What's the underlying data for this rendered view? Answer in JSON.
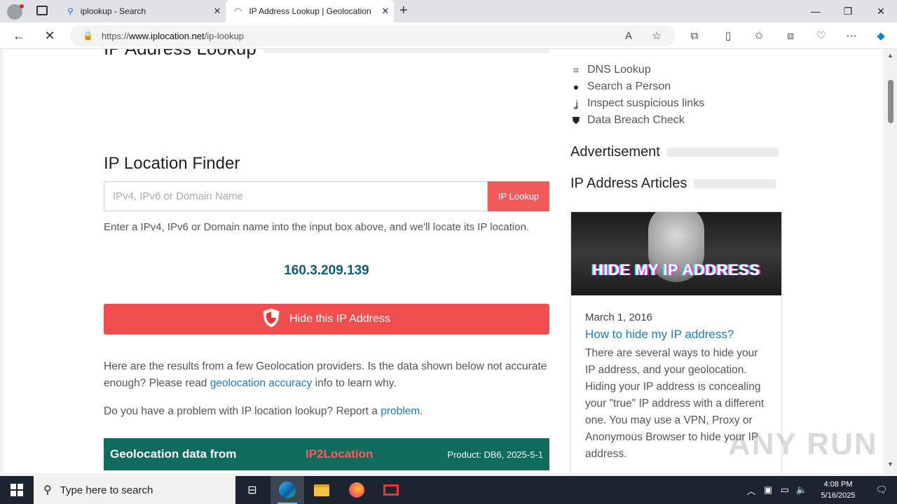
{
  "browser": {
    "tabs": [
      {
        "label": "iplookup - Search"
      },
      {
        "label": "IP Address Lookup | Geolocation"
      }
    ],
    "url_prefix": "https://",
    "url_domain": "www.iplocation.net",
    "url_path": "/ip-lookup"
  },
  "main": {
    "heading_cut": "IP Address Lookup",
    "finder_title": "IP Location Finder",
    "input_placeholder": "IPv4, IPv6 or Domain Name",
    "lookup_button": "IP Lookup",
    "hint": "Enter a IPv4, IPv6 or Domain name into the input box above, and we'll locate its IP location.",
    "current_ip": "160.3.209.139",
    "hide_button": "Hide this IP Address",
    "para1_a": "Here are the results from a few Geolocation providers. Is the data shown below not accurate enough? Please read ",
    "para1_link": "geolocation accuracy",
    "para1_b": " info to learn why.",
    "para2_a": "Do you have a problem with IP location lookup? Report a ",
    "para2_link": "problem",
    "para2_b": ".",
    "geo_title": "Geolocation data from",
    "geo_provider": "IP2Location",
    "geo_product": "Product: DB6, 2025-5-1"
  },
  "sidebar": {
    "items": [
      {
        "label": "DNS Lookup",
        "icon": "dns-icon"
      },
      {
        "label": "Search a Person",
        "icon": "person-icon"
      },
      {
        "label": "Inspect suspicious links",
        "icon": "hook-icon"
      },
      {
        "label": "Data Breach Check",
        "icon": "shield-icon"
      }
    ],
    "advertisement_heading": "Advertisement",
    "articles_heading": "IP Address Articles",
    "article": {
      "image_text": "HIDE MY IP ADDRESS",
      "date": "March 1, 2016",
      "title": "How to hide my IP address?",
      "body": "There are several ways to hide your IP address, and your geolocation. Hiding your IP address is concealing your \"true\" IP address with a different one. You may use a VPN, Proxy or Anonymous Browser to hide your IP address."
    }
  },
  "watermark": "ANY RUN",
  "taskbar": {
    "search_placeholder": "Type here to search",
    "time": "4:08 PM",
    "date": "5/16/2025"
  },
  "colors": {
    "accent_red": "#f04e4e",
    "ip_blue": "#0d5c7a",
    "link_blue": "#1a7bc4",
    "geo_green": "#0f6b5c"
  }
}
